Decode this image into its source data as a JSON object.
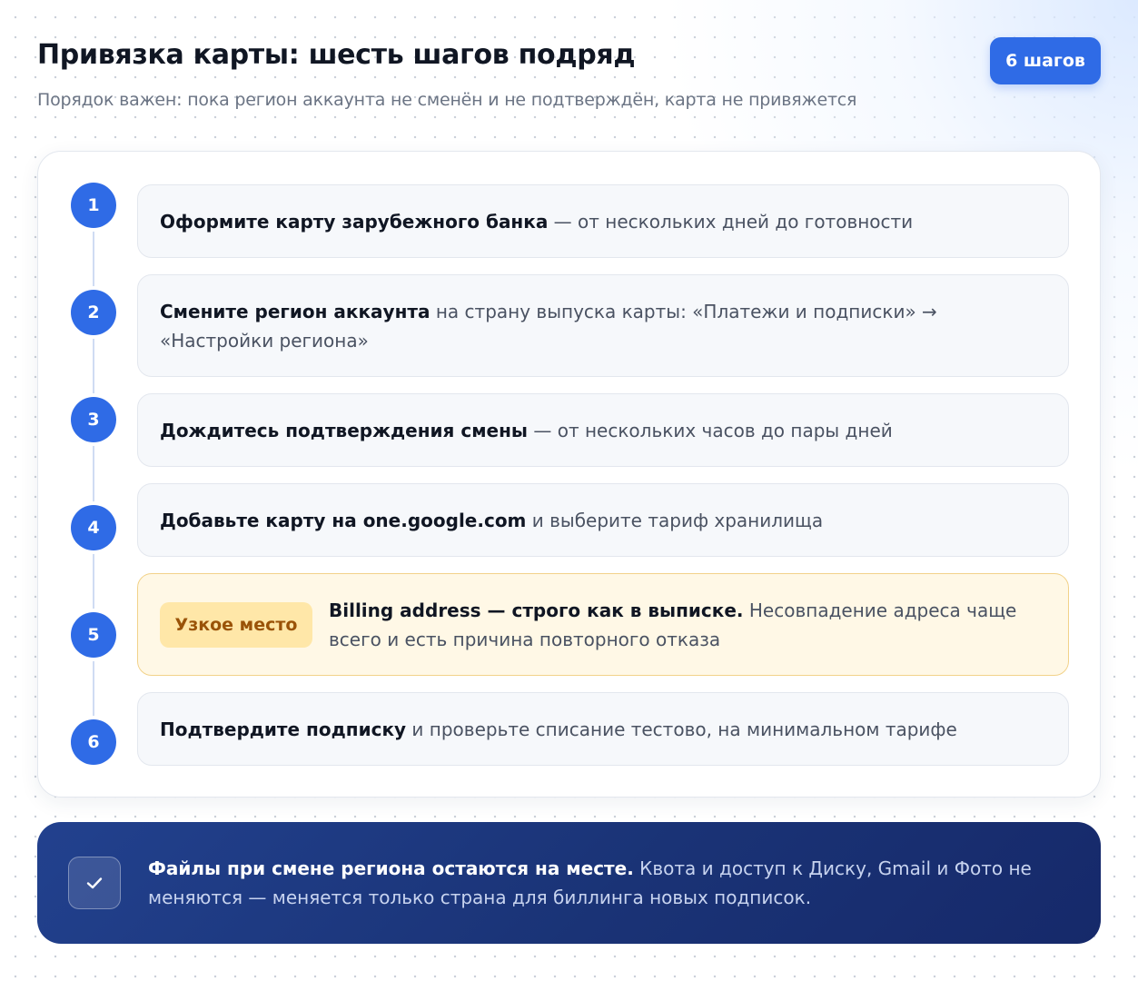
{
  "header": {
    "title": "Привязка карты: шесть шагов подряд",
    "subtitle": "Порядок важен: пока регион аккаунта не сменён и не подтверждён, карта не привяжется",
    "badge": "6 шагов"
  },
  "steps": [
    {
      "number": "1",
      "strong": "Оформите карту зарубежного банка",
      "rest": " — от нескольких дней до готовности"
    },
    {
      "number": "2",
      "strong": "Смените регион аккаунта",
      "rest": " на страну выпуска карты: «Платежи и подписки» → «Настройки региона»"
    },
    {
      "number": "3",
      "strong": "Дождитесь подтверждения смены",
      "rest": " — от нескольких часов до пары дней"
    },
    {
      "number": "4",
      "strong": "Добавьте карту на one.google.com",
      "rest": " и выберите тариф хранилища"
    },
    {
      "number": "5",
      "tag": "Узкое место",
      "strong": "Billing address — строго как в выписке.",
      "rest": " Несовпадение адреса чаще всего и есть причина повторного отказа"
    },
    {
      "number": "6",
      "strong": "Подтвердите подписку",
      "rest": " и проверьте списание тестово, на минимальном тарифе"
    }
  ],
  "footer": {
    "icon": "check-icon",
    "strong": "Файлы при смене региона остаются на месте.",
    "rest": " Квота и доступ к Диску, Gmail и Фото не меняются — меняется только страна для биллинга новых подписок."
  },
  "colors": {
    "accent": "#2f6be6",
    "warning_bg": "#fff8e6",
    "tag_text": "#9a5308",
    "footer_bg": "#1a3376"
  }
}
